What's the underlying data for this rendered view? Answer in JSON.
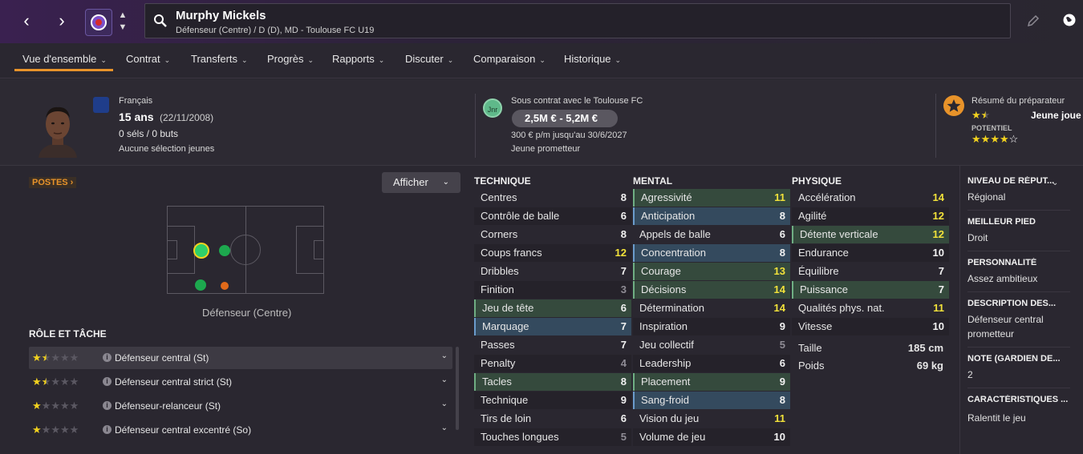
{
  "header": {
    "name": "Murphy Mickels",
    "subtitle": "Défenseur (Centre) / D (D), MD - Toulouse FC U19"
  },
  "tabs": [
    {
      "label": "Vue d'ensemble"
    },
    {
      "label": "Contrat"
    },
    {
      "label": "Transferts"
    },
    {
      "label": "Progrès"
    },
    {
      "label": "Rapports"
    },
    {
      "label": "Discuter"
    },
    {
      "label": "Comparaison"
    },
    {
      "label": "Historique"
    }
  ],
  "profile": {
    "nationality": "Français",
    "age": "15 ans",
    "dob": "(22/11/2008)",
    "caps": "0 séls / 0 buts",
    "youth_caps": "Aucune sélection jeunes"
  },
  "contract": {
    "badge": "Jnr",
    "club_text": "Sous contrat avec le Toulouse FC",
    "value": "2,5M € - 5,2M €",
    "wage": "300 € p/m jusqu'au 30/6/2027",
    "status": "Jeune prometteur"
  },
  "coach": {
    "title": "Résumé du préparateur",
    "label": "Jeune joue",
    "potential_label": "POTENTIEL",
    "ability_stars": 1.5,
    "potential_stars": 4
  },
  "positions": {
    "badge": "POSTES",
    "show_button": "Afficher",
    "caption": "Défenseur (Centre)"
  },
  "roles": {
    "title": "RÔLE ET TÂCHE",
    "items": [
      {
        "label": "Défenseur central (St)",
        "stars": 1.5
      },
      {
        "label": "Défenseur central strict (St)",
        "stars": 1.5
      },
      {
        "label": "Défenseur-relanceur (St)",
        "stars": 1
      },
      {
        "label": "Défenseur central excentré (So)",
        "stars": 1
      }
    ]
  },
  "technique": {
    "title": "TECHNIQUE",
    "rows": [
      {
        "name": "Centres",
        "value": 8
      },
      {
        "name": "Contrôle de balle",
        "value": 6
      },
      {
        "name": "Corners",
        "value": 8
      },
      {
        "name": "Coups francs",
        "value": 12
      },
      {
        "name": "Dribbles",
        "value": 7
      },
      {
        "name": "Finition",
        "value": 3
      },
      {
        "name": "Jeu de tête",
        "value": 6
      },
      {
        "name": "Marquage",
        "value": 7
      },
      {
        "name": "Passes",
        "value": 7
      },
      {
        "name": "Penalty",
        "value": 4
      },
      {
        "name": "Tacles",
        "value": 8
      },
      {
        "name": "Technique",
        "value": 9
      },
      {
        "name": "Tirs de loin",
        "value": 6
      },
      {
        "name": "Touches longues",
        "value": 5
      }
    ]
  },
  "mental": {
    "title": "MENTAL",
    "rows": [
      {
        "name": "Agressivité",
        "value": 11
      },
      {
        "name": "Anticipation",
        "value": 8
      },
      {
        "name": "Appels de balle",
        "value": 6
      },
      {
        "name": "Concentration",
        "value": 8
      },
      {
        "name": "Courage",
        "value": 13
      },
      {
        "name": "Décisions",
        "value": 14
      },
      {
        "name": "Détermination",
        "value": 14
      },
      {
        "name": "Inspiration",
        "value": 9
      },
      {
        "name": "Jeu collectif",
        "value": 5
      },
      {
        "name": "Leadership",
        "value": 6
      },
      {
        "name": "Placement",
        "value": 9
      },
      {
        "name": "Sang-froid",
        "value": 8
      },
      {
        "name": "Vision du jeu",
        "value": 11
      },
      {
        "name": "Volume de jeu",
        "value": 10
      }
    ]
  },
  "physique": {
    "title": "PHYSIQUE",
    "rows": [
      {
        "name": "Accélération",
        "value": 14
      },
      {
        "name": "Agilité",
        "value": 12
      },
      {
        "name": "Détente verticale",
        "value": 12
      },
      {
        "name": "Endurance",
        "value": 10
      },
      {
        "name": "Équilibre",
        "value": 7
      },
      {
        "name": "Puissance",
        "value": 7
      },
      {
        "name": "Qualités phys. nat.",
        "value": 11
      },
      {
        "name": "Vitesse",
        "value": 10
      }
    ],
    "height_label": "Taille",
    "height": "185 cm",
    "weight_label": "Poids",
    "weight": "69 kg"
  },
  "sidebar": {
    "reputation_label": "NIVEAU DE RÉPUT...",
    "reputation": "Régional",
    "foot_label": "MEILLEUR PIED",
    "foot": "Droit",
    "personality_label": "PERSONNALITÉ",
    "personality": "Assez ambitieux",
    "description_label": "DESCRIPTION DES...",
    "description": "Défenseur central prometteur",
    "note_label": "NOTE (GARDIEN DE...",
    "note": "2",
    "traits_label": "CARACTÉRISTIQUES ...",
    "traits": "Ralentit le jeu"
  },
  "colors": {
    "accent": "#e8932a",
    "highlight_value": "#f2e23a",
    "row_blue": "#344a5e",
    "row_green": "#354a3d"
  }
}
